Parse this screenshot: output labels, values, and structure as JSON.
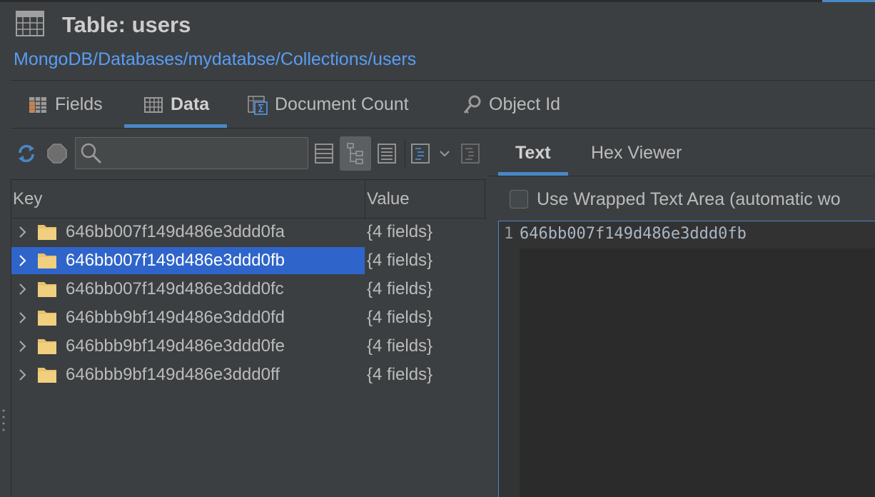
{
  "header": {
    "title": "Table: users",
    "breadcrumb": "MongoDB/Databases/mydatabse/Collections/users"
  },
  "tabs": [
    {
      "label": "Fields",
      "icon": "table-icon"
    },
    {
      "label": "Data",
      "icon": "grid-icon",
      "active": true
    },
    {
      "label": "Document Count",
      "icon": "sum-table-icon"
    },
    {
      "label": "Object Id",
      "icon": "key-icon"
    }
  ],
  "toolbar": {
    "search_value": "",
    "search_placeholder": "",
    "buttons": [
      "refresh-icon",
      "stop-icon",
      "table-view-icon",
      "tree-view-icon",
      "text-view-icon",
      "filter-icon",
      "chevron-down-icon",
      "export-icon"
    ]
  },
  "tree": {
    "columns": {
      "key": "Key",
      "value": "Value"
    },
    "rows": [
      {
        "key": "646bb007f149d486e3ddd0fa",
        "value": "{4 fields}"
      },
      {
        "key": "646bb007f149d486e3ddd0fb",
        "value": "{4 fields}",
        "selected": true
      },
      {
        "key": "646bb007f149d486e3ddd0fc",
        "value": "{4 fields}"
      },
      {
        "key": "646bbb9bf149d486e3ddd0fd",
        "value": "{4 fields}"
      },
      {
        "key": "646bbb9bf149d486e3ddd0fe",
        "value": "{4 fields}"
      },
      {
        "key": "646bbb9bf149d486e3ddd0ff",
        "value": "{4 fields}"
      }
    ]
  },
  "viewer": {
    "tabs": [
      {
        "label": "Text",
        "active": true
      },
      {
        "label": "Hex Viewer"
      }
    ],
    "wrap_label": "Use Wrapped Text Area (automatic wo",
    "line_number": "1",
    "content": "646bb007f149d486e3ddd0fb"
  },
  "colors": {
    "accent": "#4a88c7",
    "selection": "#2f65ca",
    "link": "#589df6",
    "folder": "#e8c26d"
  }
}
